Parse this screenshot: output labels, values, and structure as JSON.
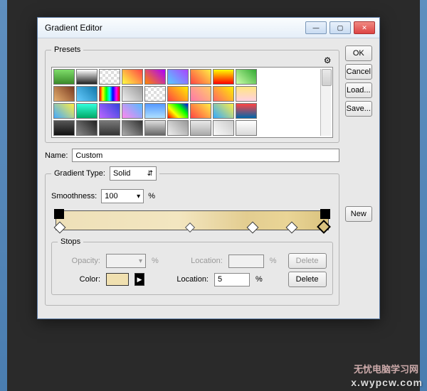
{
  "window": {
    "title": "Gradient Editor"
  },
  "buttons": {
    "ok": "OK",
    "cancel": "Cancel",
    "load": "Load...",
    "save": "Save...",
    "new": "New"
  },
  "presets": {
    "legend": "Presets",
    "gear": "⚙"
  },
  "name": {
    "label": "Name:",
    "value": "Custom"
  },
  "gradtype": {
    "label": "Gradient Type:",
    "value": "Solid"
  },
  "smooth": {
    "label": "Smoothness:",
    "value": "100",
    "unit": "%"
  },
  "stops": {
    "legend": "Stops",
    "opacity": {
      "label": "Opacity:",
      "value": "",
      "unit": "%",
      "delete": "Delete"
    },
    "location1": {
      "label": "Location:",
      "value": "",
      "unit": "%"
    },
    "color": {
      "label": "Color:"
    },
    "location2": {
      "label": "Location:",
      "value": "5",
      "unit": "%",
      "delete": "Delete"
    }
  },
  "swatches": [
    "linear-gradient(#7edc6a,#3a8a2a)",
    "linear-gradient(#fff,#222)",
    "repeating-conic-gradient(#ddd 0 25%,#fff 0 50%) 0/8px 8px",
    "linear-gradient(45deg,#ff4,#f44)",
    "linear-gradient(45deg,#f80,#a0f)",
    "linear-gradient(45deg,#5cf,#a4f)",
    "linear-gradient(45deg,#f44,#fe4)",
    "linear-gradient(#ff0,#f00)",
    "linear-gradient(45deg,#cfa,#3a3)",
    "linear-gradient(45deg,#e6b070,#7a3a20)",
    "linear-gradient(45deg,#6cf,#17a)",
    "linear-gradient(90deg,red,yellow,lime,cyan,blue,magenta,red)",
    "linear-gradient(45deg,#eee,#999)",
    "repeating-conic-gradient(#ddd 0 25%,#fff 0 50%) 0/8px 8px",
    "linear-gradient(45deg,#f44,#fe0)",
    "linear-gradient(45deg,#f7a,#fc6)",
    "linear-gradient(45deg,#f66,#fe0)",
    "linear-gradient(#ffe680,#ffd0e0)",
    "linear-gradient(45deg,#4af,#fe4)",
    "linear-gradient(#3fd,#0a6)",
    "linear-gradient(45deg,#b6f,#34d)",
    "linear-gradient(45deg,#f8e,#5bf)",
    "linear-gradient(#59f,#addfff)",
    "linear-gradient(45deg,red,yellow,lime,blue)",
    "linear-gradient(45deg,#f44,#fe4)",
    "linear-gradient(45deg,#3af,#fe4)",
    "linear-gradient(#f44,#06a)",
    "linear-gradient(#555,#111)",
    "linear-gradient(45deg,#888,#222)",
    "linear-gradient(#777,#333)",
    "linear-gradient(45deg,#aaa,#333)",
    "linear-gradient(#ddd,#666)",
    "linear-gradient(45deg,#eee,#999)",
    "linear-gradient(#e8e8e8,#aaa)",
    "linear-gradient(45deg,#fafafa,#ccc)",
    "linear-gradient(#fff,#d9d9d9)"
  ],
  "watermark": {
    "cn": "无忧电脑学习网",
    "url": "x.wypcw.com"
  }
}
